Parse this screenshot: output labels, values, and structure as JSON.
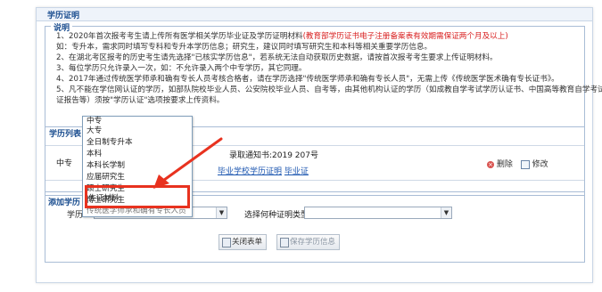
{
  "panel_title": "学历证明",
  "desc": {
    "title": "说明",
    "l1_a": "1、2020年首次报考考生请上传所有医学相关学历毕业证及学历证明材料",
    "l1_b": "(教育部学历证书电子注册备案表有效期需保证两个月及以上)",
    "l2": "如：专升本，需求同时填写专科和专升本学历信息；研究生，建议同时填写研究生和本科等相关重要学历信息。",
    "l3": "2、在湖北考区报考的历史考生请先选择\"已核实学历信息\"，若系统无法自动获取历史数据，请按首次报考考生要求上传证明材料。",
    "l4": "3、每位学历只允许录入一次，如：不允许录入两个中专学历，其它同理。",
    "l5": "4、2017年通过传统医学师承和确有专长人员考核合格者，请在学历选择\"传统医学师承和确有专长人员\"，无需上传《传统医学医术确有专长证书》。",
    "l6": "5、凡不能在学信网认证的学历，如部队院校毕业人员、公安院校毕业人员、自考等，由其他机构认证的学历（如成教自学考试学历认证书、中国高等教育自学考试学历认",
    "l7": "证报告等）须按\"学历认证\"选项按要求上传资料。"
  },
  "list": {
    "legend": "学历列表",
    "row": {
      "level": "中专",
      "info": "录取通知书:2019 207号",
      "link1": "毕业学校学历证明",
      "link2": "毕业证",
      "delete": "删除",
      "edit": "修改"
    }
  },
  "add": {
    "legend": "添加学历",
    "xueli_label": "学历:",
    "type_label": "选择何种证明类型:",
    "close_button": "关闭表单",
    "save_button": "保存学历信息"
  },
  "dropdown": {
    "options": [
      "中专",
      "大专",
      "全日制专升本",
      "本科",
      "本科长学制",
      "应届研究生",
      "硕士研究生",
      "博士研究生",
      "传统医学师承和确有专长人员"
    ],
    "highlighted": "佐证材料"
  },
  "icons": [
    "delete-icon",
    "edit-icon",
    "close-form-icon",
    "save-icon",
    "chevron-down-icon"
  ],
  "colors": {
    "annotation_red": "#e8321f",
    "title_blue": "#1a4d8f",
    "warning_text": "#d81e1e"
  }
}
